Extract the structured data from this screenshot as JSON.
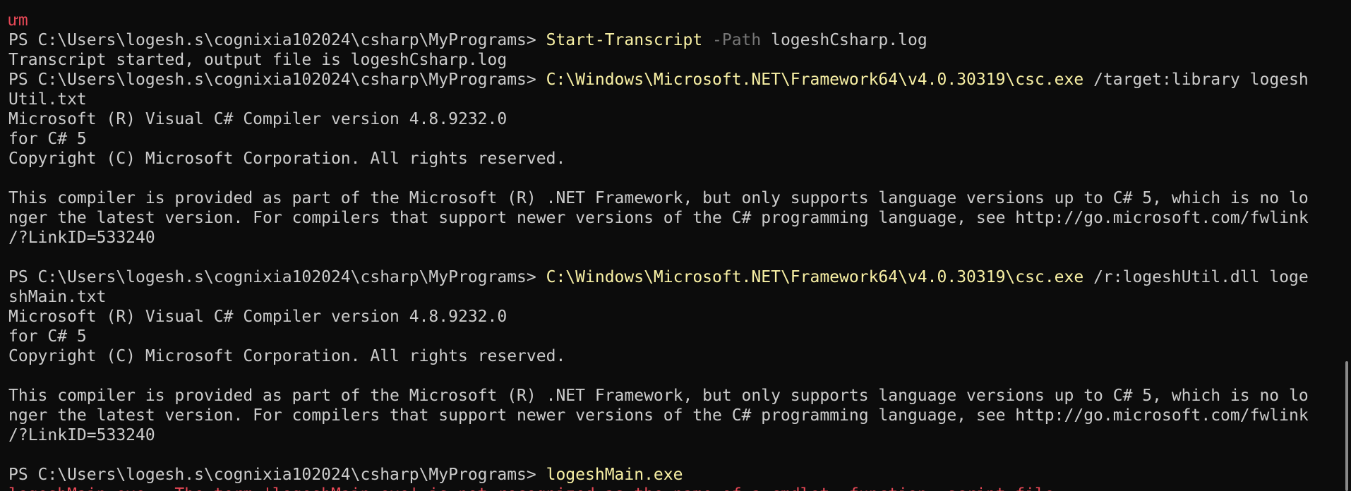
{
  "terminal": {
    "lines": {
      "l0": {
        "text": "ưm"
      },
      "l1": {
        "prompt": "PS C:\\Users\\logesh.s\\cognixia102024\\csharp\\MyPrograms> ",
        "cmd": "Start-Transcript",
        "param": " -Path",
        "rest": " logeshCsharp.log"
      },
      "l2": {
        "text": "Transcript started, output file is logeshCsharp.log"
      },
      "l3": {
        "prompt": "PS C:\\Users\\logesh.s\\cognixia102024\\csharp\\MyPrograms> ",
        "cmd": "C:\\Windows\\Microsoft.NET\\Framework64\\v4.0.30319\\csc.exe",
        "rest": " /target:library logesh"
      },
      "l4": {
        "text": "Util.txt"
      },
      "l5": {
        "text": "Microsoft (R) Visual C# Compiler version 4.8.9232.0"
      },
      "l6": {
        "text": "for C# 5"
      },
      "l7": {
        "text": "Copyright (C) Microsoft Corporation. All rights reserved."
      },
      "l8": {
        "text": ""
      },
      "l9": {
        "text": "This compiler is provided as part of the Microsoft (R) .NET Framework, but only supports language versions up to C# 5, which is no lo"
      },
      "l10": {
        "text": "nger the latest version. For compilers that support newer versions of the C# programming language, see http://go.microsoft.com/fwlink"
      },
      "l11": {
        "text": "/?LinkID=533240"
      },
      "l12": {
        "text": ""
      },
      "l13": {
        "prompt": "PS C:\\Users\\logesh.s\\cognixia102024\\csharp\\MyPrograms> ",
        "cmd": "C:\\Windows\\Microsoft.NET\\Framework64\\v4.0.30319\\csc.exe",
        "rest": " /r:logeshUtil.dll loge"
      },
      "l14": {
        "text": "shMain.txt"
      },
      "l15": {
        "text": "Microsoft (R) Visual C# Compiler version 4.8.9232.0"
      },
      "l16": {
        "text": "for C# 5"
      },
      "l17": {
        "text": "Copyright (C) Microsoft Corporation. All rights reserved."
      },
      "l18": {
        "text": ""
      },
      "l19": {
        "text": "This compiler is provided as part of the Microsoft (R) .NET Framework, but only supports language versions up to C# 5, which is no lo"
      },
      "l20": {
        "text": "nger the latest version. For compilers that support newer versions of the C# programming language, see http://go.microsoft.com/fwlink"
      },
      "l21": {
        "text": "/?LinkID=533240"
      },
      "l22": {
        "text": ""
      },
      "l23": {
        "prompt": "PS C:\\Users\\logesh.s\\cognixia102024\\csharp\\MyPrograms> ",
        "cmd": "logeshMain.exe"
      },
      "l24": {
        "text": "logeshMain.exe : The term 'logeshMain.exe' is not recognized as the name of a cmdlet, function, script file"
      }
    }
  },
  "colors": {
    "background": "#0c0c0c",
    "foreground": "#cccccc",
    "command": "#f9f1a5",
    "parameter": "#767676",
    "error": "#e74856"
  }
}
